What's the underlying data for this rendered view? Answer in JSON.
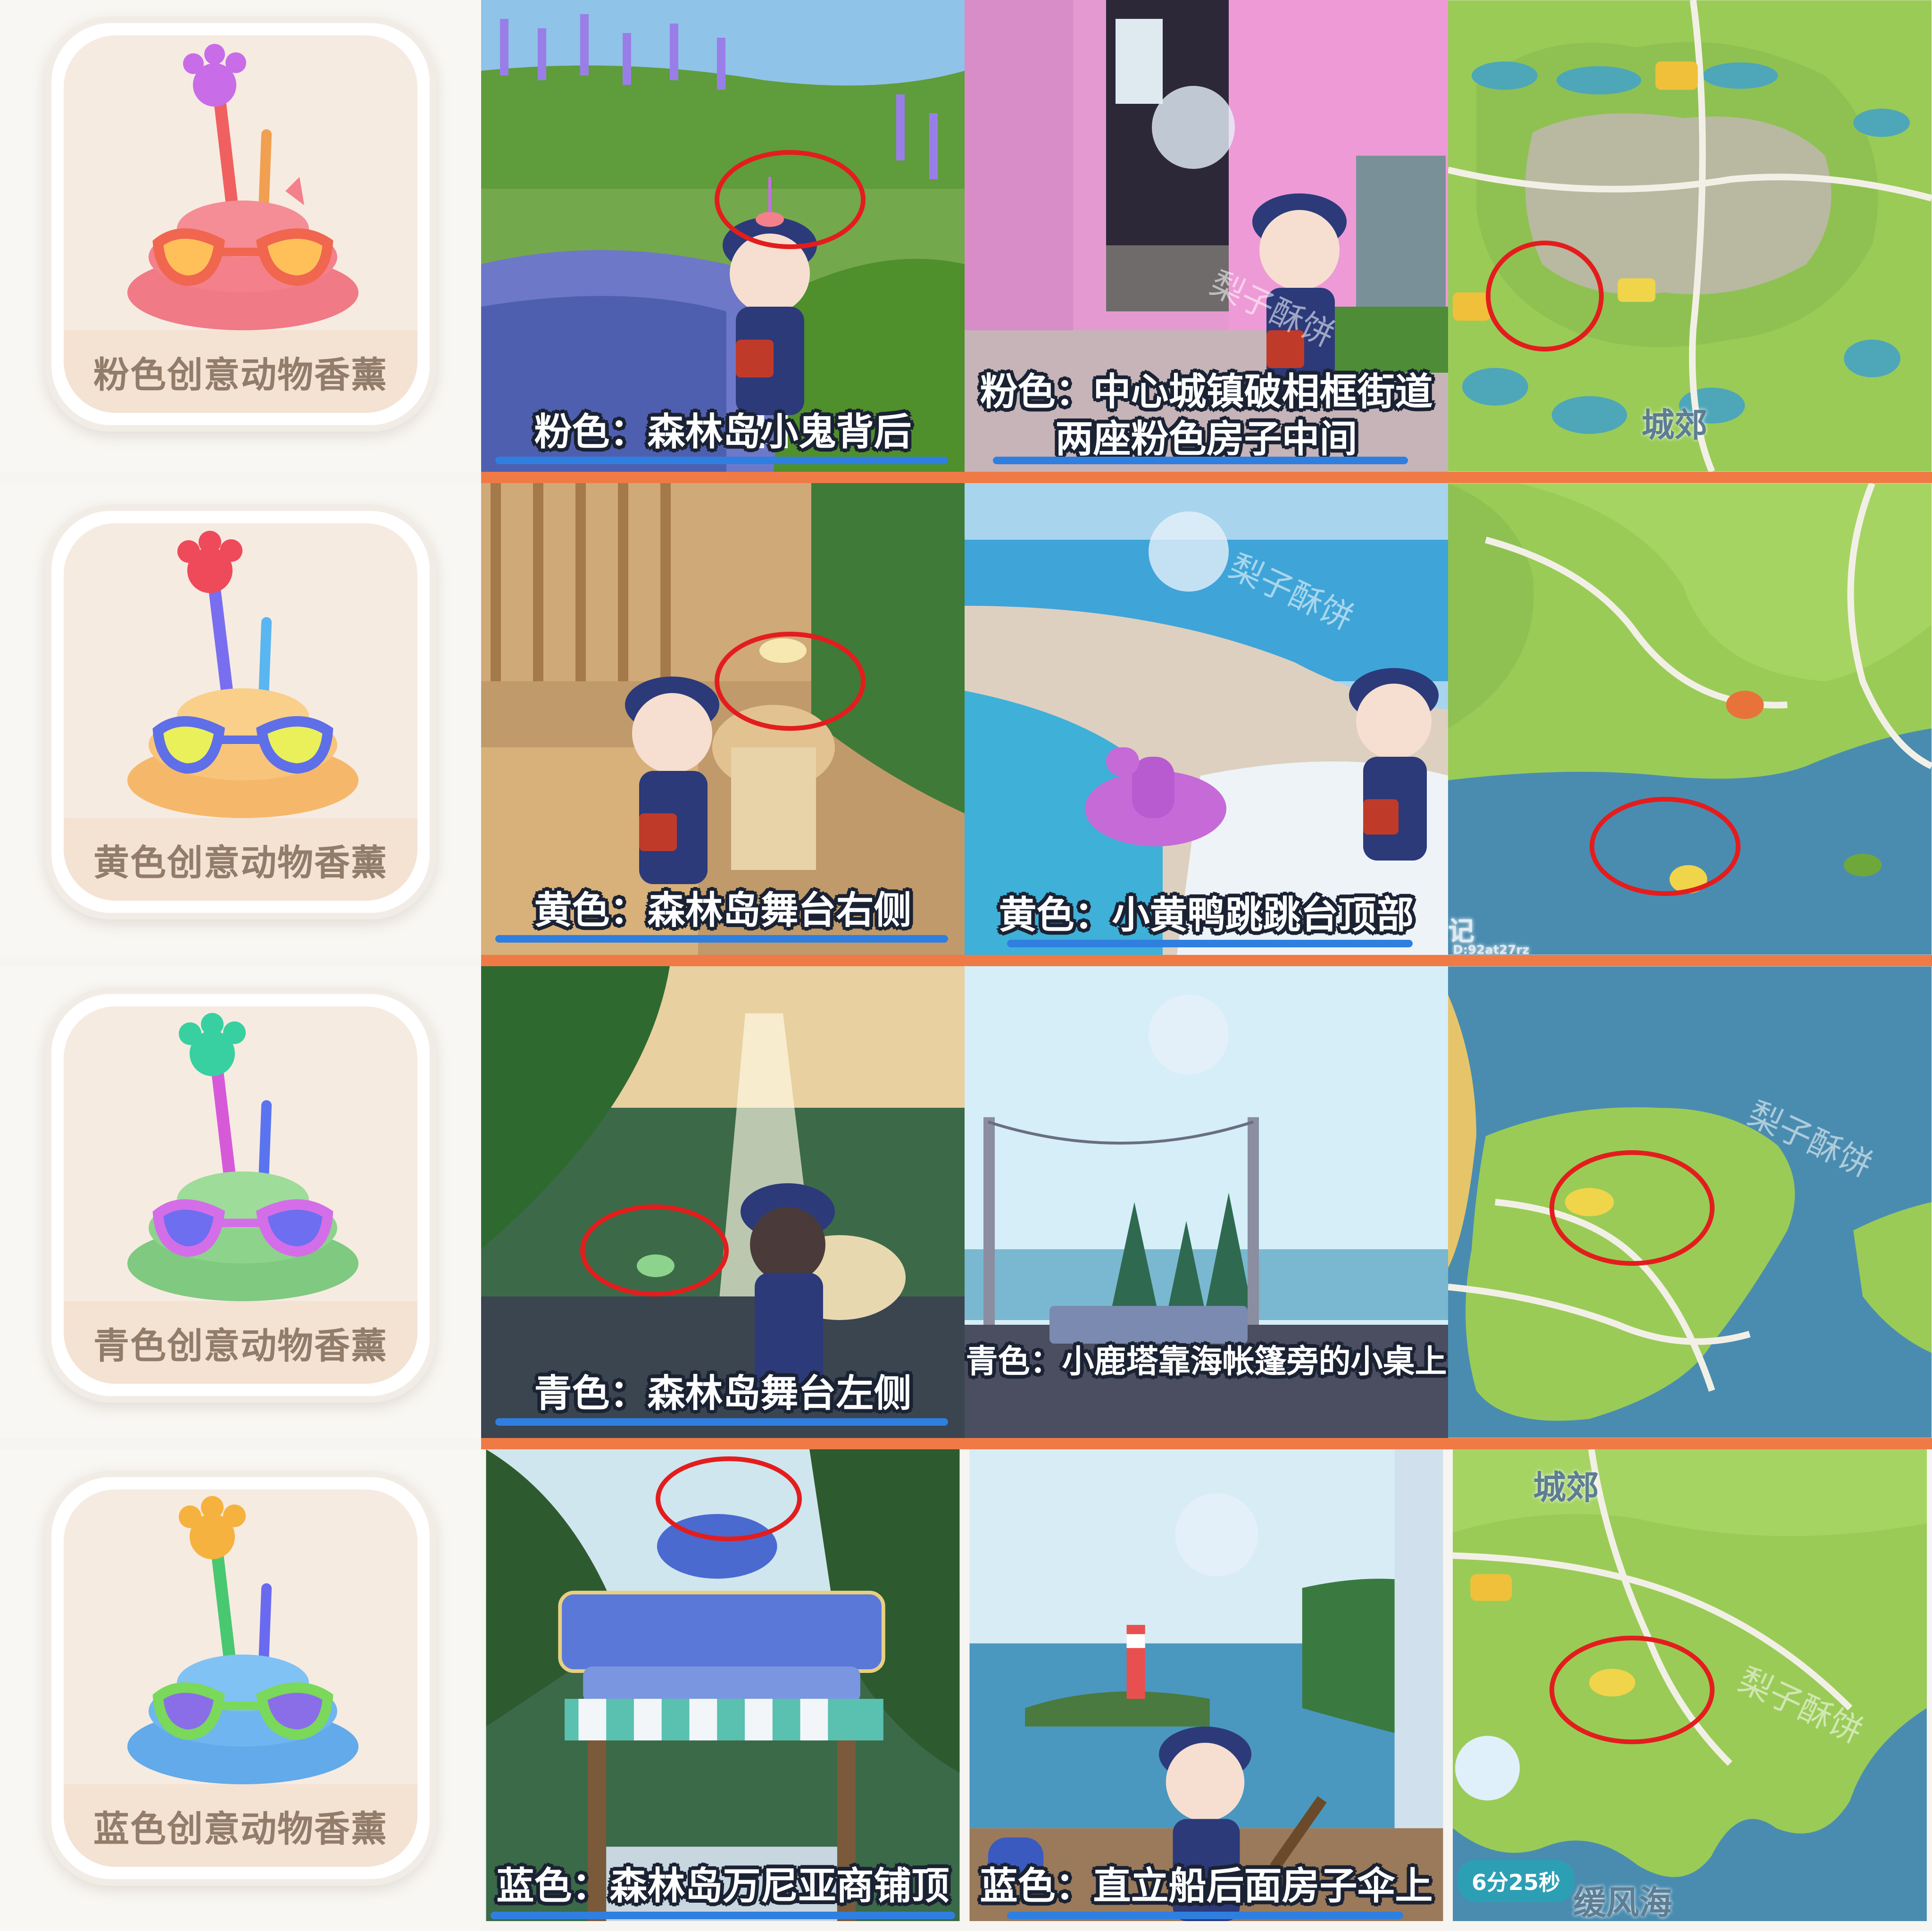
{
  "rows": [
    {
      "item_label": "粉色创意动物香薰",
      "item_colors": {
        "body": "#f3808a",
        "glasses": "#f0664f",
        "lens": "#ffc05a",
        "paw": "#c96ce8",
        "stick1": "#f06060",
        "stick2": "#f0a050"
      },
      "scene1_caption": "粉色：森林岛小鬼背后",
      "scene2_caption_line1": "粉色：中心城镇破相框街道",
      "scene2_caption_line2": "两座粉色房子中间",
      "map_label": "城郊"
    },
    {
      "item_label": "黄色创意动物香薰",
      "item_colors": {
        "body": "#f7c47a",
        "glasses": "#5e6fe8",
        "lens": "#e9f05a",
        "paw": "#ee4a5a",
        "stick1": "#7a6ef0",
        "stick2": "#59b6f0"
      },
      "scene1_caption": "黄色：森林岛舞台右侧",
      "scene2_caption_line1": "黄色：小黄鸭跳跳台顶部",
      "map_text_left": "记",
      "map_code": "D:92at27rz"
    },
    {
      "item_label": "青色创意动物香薰",
      "item_colors": {
        "body": "#8ed38c",
        "glasses": "#d46ee8",
        "lens": "#6e6ef0",
        "paw": "#38d0a0",
        "stick1": "#d65ad8",
        "stick2": "#5a74f0"
      },
      "scene1_caption": "青色：森林岛舞台左侧",
      "scene2_caption_line1": "青色：小鹿塔靠海帐篷旁的小桌上"
    },
    {
      "item_label": "蓝色创意动物香薰",
      "item_colors": {
        "body": "#6fb6f0",
        "glasses": "#7ad85a",
        "lens": "#8a6ee8",
        "paw": "#f6b23e",
        "stick1": "#48c870",
        "stick2": "#6a6af0"
      },
      "scene1_caption": "蓝色：森林岛万尼亚商铺顶",
      "scene2_caption_line1": "蓝色：直立船后面房子伞上",
      "map_label_top": "城郊",
      "map_label_bottom": "缓风海",
      "map_timer": "6分25秒"
    }
  ],
  "watermark": "梨子酥饼"
}
